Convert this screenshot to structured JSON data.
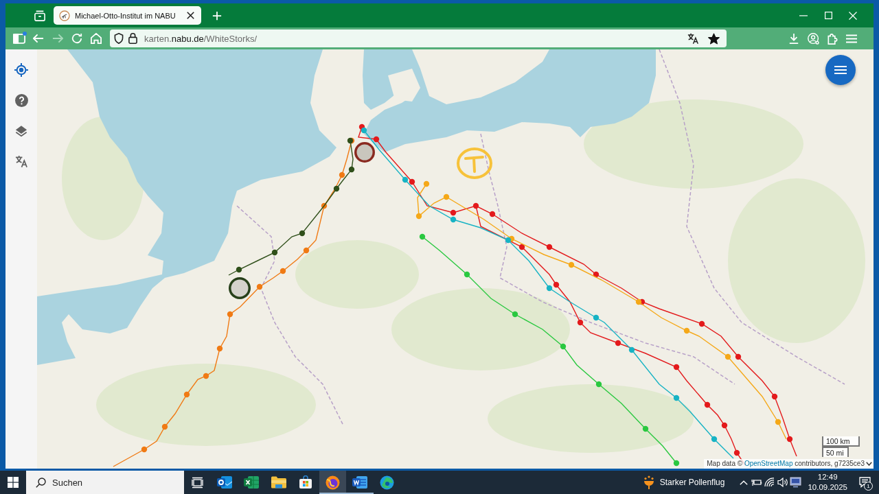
{
  "browser": {
    "tabs": [
      {
        "title": "Michael-Otto-Institut im NABU",
        "selected": true
      }
    ],
    "sidebar_notification": true,
    "nav": [
      {
        "kind": "back",
        "disabled": false
      },
      {
        "kind": "forward",
        "disabled": true
      },
      {
        "kind": "reload",
        "disabled": false
      },
      {
        "kind": "home",
        "disabled": false
      }
    ],
    "url": "karten.**nabu.de**/WhiteStorks/",
    "bookmarked": true
  },
  "map": {
    "tools": [
      {
        "kind": "locate",
        "selected": true
      },
      {
        "kind": "help",
        "selected": false
      },
      {
        "kind": "layers",
        "selected": false
      },
      {
        "kind": "translate",
        "selected": false
      }
    ],
    "tracks": [
      {
        "color": "#f07a14"
      },
      {
        "color": "#2f4f1a"
      },
      {
        "color": "#e31a1c"
      },
      {
        "color": "#e31a1c"
      },
      {
        "color": "#f5a818"
      },
      {
        "color": "#17b3c4"
      },
      {
        "color": "#2ac840"
      }
    ],
    "scale": [
      "100 km",
      "50 mi"
    ],
    "attribution": {
      "prefix": "Map data © ",
      "link": "OpenStreetMap",
      "suffix": " contributors, g7235ce3"
    }
  },
  "taskbar": {
    "search": {
      "placeholder": "Suchen"
    },
    "apps": [
      {
        "kind": "mail",
        "open": false,
        "selected": false
      },
      {
        "kind": "spreadsheet",
        "open": false,
        "selected": false
      },
      {
        "kind": "folder",
        "open": false,
        "selected": false
      },
      {
        "kind": "store",
        "open": false,
        "selected": false
      },
      {
        "kind": "browser",
        "open": true,
        "selected": true
      },
      {
        "kind": "document",
        "open": true,
        "selected": false
      },
      {
        "kind": "web",
        "open": false,
        "selected": false
      }
    ],
    "weather": "Starker Pollenflug",
    "time": "12:49",
    "date": "10.09.2025",
    "notifications": "1"
  }
}
